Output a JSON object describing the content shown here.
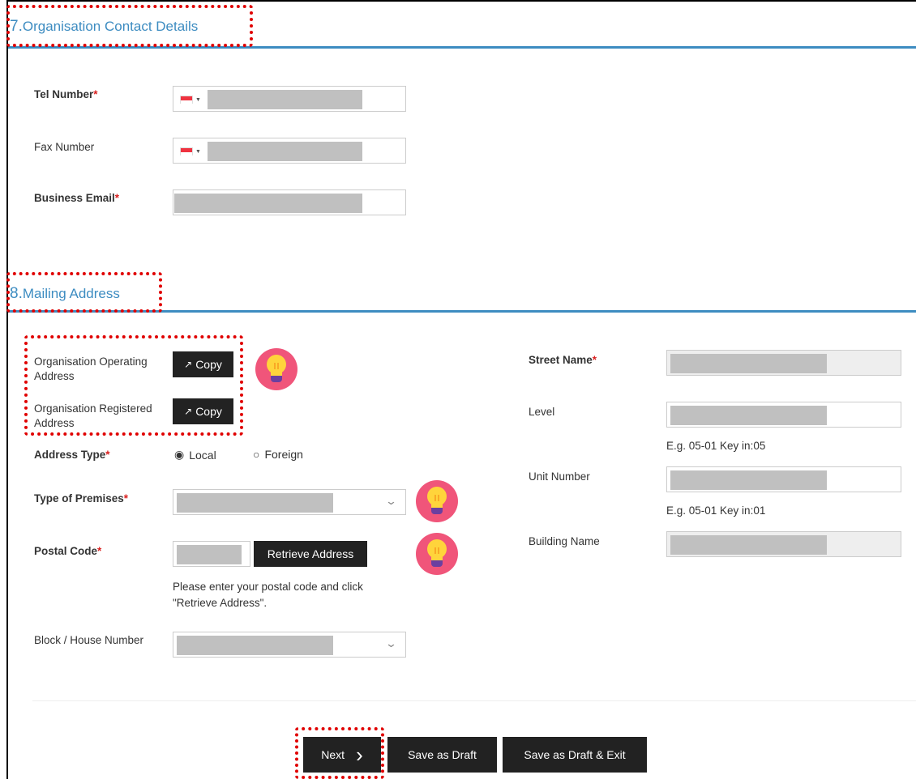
{
  "sections": {
    "contact": {
      "number": "7.",
      "title": "Organisation Contact Details"
    },
    "mailing": {
      "number": "8.",
      "title": "Mailing Address"
    }
  },
  "contact": {
    "tel_label": "Tel Number",
    "fax_label": "Fax Number",
    "email_label": "Business Email",
    "required_mark": "*"
  },
  "mailing": {
    "operating_address_label": "Organisation Operating Address",
    "registered_address_label": "Organisation Registered Address",
    "copy_label": "Copy",
    "address_type_label": "Address Type",
    "address_type_options": [
      "Local",
      "Foreign"
    ],
    "address_type_selected": "Local",
    "premises_label": "Type of Premises",
    "postal_label": "Postal Code",
    "retrieve_label": "Retrieve Address",
    "postal_hint_1": "Please enter your postal code and click",
    "postal_hint_2": "\"Retrieve Address\".",
    "block_label": "Block / House Number",
    "street_label": "Street Name",
    "level_label": "Level",
    "level_hint": "E.g. 05-01 Key in:05",
    "unit_label": "Unit Number",
    "unit_hint": "E.g. 05-01 Key in:01",
    "building_label": "Building Name"
  },
  "footer": {
    "next_label": "Next",
    "save_draft_label": "Save as Draft",
    "save_exit_label": "Save as Draft & Exit"
  },
  "icons": {
    "country_flag": "singapore-flag-icon",
    "tip": "lightbulb-icon",
    "copy": "external-link-icon",
    "chevron": "chevron-down-icon",
    "next": "chevron-right-icon"
  },
  "colors": {
    "accent": "#3d8cc1",
    "required": "#d9201f",
    "button": "#222222",
    "highlight": "#e00000"
  }
}
